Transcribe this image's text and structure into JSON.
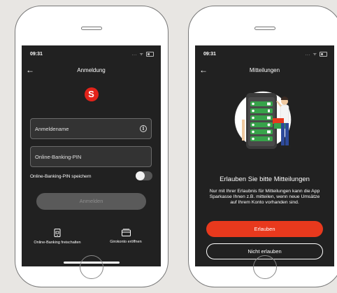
{
  "left_screen": {
    "status_time": "09:31",
    "nav_title": "Anmeldung",
    "logo_glyph": "S",
    "username_placeholder": "Anmeldename",
    "pin_placeholder": "Online-Banking-PIN",
    "save_pin_label": "Online-Banking-PIN speichern",
    "save_pin_enabled": false,
    "login_button": "Anmelden",
    "unlock_link": "Online-Banking freischalten",
    "open_account_link": "Girokonto eröffnen"
  },
  "right_screen": {
    "status_time": "09:31",
    "nav_title": "Mitteilungen",
    "headline": "Erlauben Sie bitte Mitteilungen",
    "paragraph": "Nur mit Ihrer Erlaubnis für Mitteilungen kann die App Sparkasse Ihnen z.B. mitteilen, wenn neue Umsätze auf Ihrem Konto vorhanden sind.",
    "allow_button": "Erlauben",
    "deny_button": "Nicht erlauben"
  },
  "colors": {
    "accent_red": "#e8391d",
    "logo_red": "#e2231a",
    "screen_bg": "#212121",
    "illustration_green": "#37a34a"
  },
  "icons": [
    "back-arrow-icon",
    "info-icon",
    "sparkasse-logo-icon",
    "unlock-device-icon",
    "card-icon",
    "notification-phone-illustration"
  ]
}
